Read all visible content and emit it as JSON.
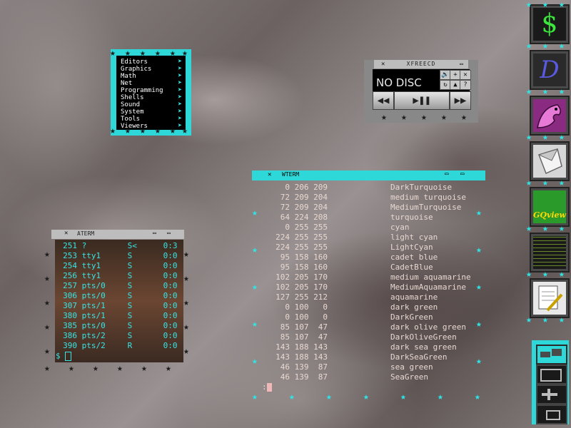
{
  "menu": {
    "items": [
      {
        "label": "Editors"
      },
      {
        "label": "Graphics"
      },
      {
        "label": "Math"
      },
      {
        "label": "Net"
      },
      {
        "label": "Programming"
      },
      {
        "label": "Shells"
      },
      {
        "label": "Sound"
      },
      {
        "label": "System"
      },
      {
        "label": "Tools"
      },
      {
        "label": "Viewers"
      }
    ]
  },
  "xfreecd": {
    "title": "XFREECD",
    "status": "NO DISC",
    "buttons": [
      "🔊",
      "+",
      "✕",
      "↻",
      "▲",
      "?"
    ],
    "controls": [
      "◀◀",
      "▶❚❚",
      "▶▶"
    ]
  },
  "bigterm": {
    "title": "WTERM",
    "rows": [
      {
        "nums": "  0 206 209",
        "name": "DarkTurquoise"
      },
      {
        "nums": " 72 209 204",
        "name": "medium turquoise"
      },
      {
        "nums": " 72 209 204",
        "name": "MediumTurquoise"
      },
      {
        "nums": " 64 224 208",
        "name": "turquoise"
      },
      {
        "nums": "  0 255 255",
        "name": "cyan"
      },
      {
        "nums": "224 255 255",
        "name": "light cyan"
      },
      {
        "nums": "224 255 255",
        "name": "LightCyan"
      },
      {
        "nums": " 95 158 160",
        "name": "cadet blue"
      },
      {
        "nums": " 95 158 160",
        "name": "CadetBlue"
      },
      {
        "nums": "102 205 170",
        "name": "medium aquamarine"
      },
      {
        "nums": "102 205 170",
        "name": "MediumAquamarine"
      },
      {
        "nums": "127 255 212",
        "name": "aquamarine"
      },
      {
        "nums": "  0 100   0",
        "name": "dark green"
      },
      {
        "nums": "  0 100   0",
        "name": "DarkGreen"
      },
      {
        "nums": " 85 107  47",
        "name": "dark olive green"
      },
      {
        "nums": " 85 107  47",
        "name": "DarkOliveGreen"
      },
      {
        "nums": "143 188 143",
        "name": "dark sea green"
      },
      {
        "nums": "143 188 143",
        "name": "DarkSeaGreen"
      },
      {
        "nums": " 46 139  87",
        "name": "sea green"
      },
      {
        "nums": " 46 139  87",
        "name": "SeaGreen"
      }
    ],
    "prompt": ":"
  },
  "smterm": {
    "title": "ATERM",
    "rows": [
      {
        "pid": "251",
        "tty": "?",
        "stat": "S<",
        "time": "0:3"
      },
      {
        "pid": "253",
        "tty": "tty1",
        "stat": "S",
        "time": "0:0"
      },
      {
        "pid": "254",
        "tty": "tty1",
        "stat": "S",
        "time": "0:0"
      },
      {
        "pid": "256",
        "tty": "tty1",
        "stat": "S",
        "time": "0:0"
      },
      {
        "pid": "257",
        "tty": "pts/0",
        "stat": "S",
        "time": "0:0"
      },
      {
        "pid": "306",
        "tty": "pts/0",
        "stat": "S",
        "time": "0:0"
      },
      {
        "pid": "307",
        "tty": "pts/1",
        "stat": "S",
        "time": "0:0"
      },
      {
        "pid": "380",
        "tty": "pts/1",
        "stat": "S",
        "time": "0:0"
      },
      {
        "pid": "385",
        "tty": "pts/0",
        "stat": "S",
        "time": "0:0"
      },
      {
        "pid": "386",
        "tty": "pts/2",
        "stat": "S",
        "time": "0:0"
      },
      {
        "pid": "390",
        "tty": "pts/2",
        "stat": "R",
        "time": "0:0"
      }
    ],
    "prompt": "$"
  },
  "dock": {
    "items": [
      {
        "name": "dollar-app-icon",
        "glyph": "$"
      },
      {
        "name": "d-app-icon",
        "glyph": "D"
      },
      {
        "name": "dragon-app-icon",
        "glyph": ""
      },
      {
        "name": "crystal-app-icon",
        "glyph": ""
      },
      {
        "name": "gqview-app-icon",
        "glyph": "GQview"
      },
      {
        "name": "spreadsheet-app-icon",
        "glyph": ""
      },
      {
        "name": "notepad-app-icon",
        "glyph": ""
      }
    ]
  },
  "colors": {
    "accent": "#2fd8d8",
    "term_text": "#e8d8d0",
    "small_term_text": "#36e6e6"
  }
}
